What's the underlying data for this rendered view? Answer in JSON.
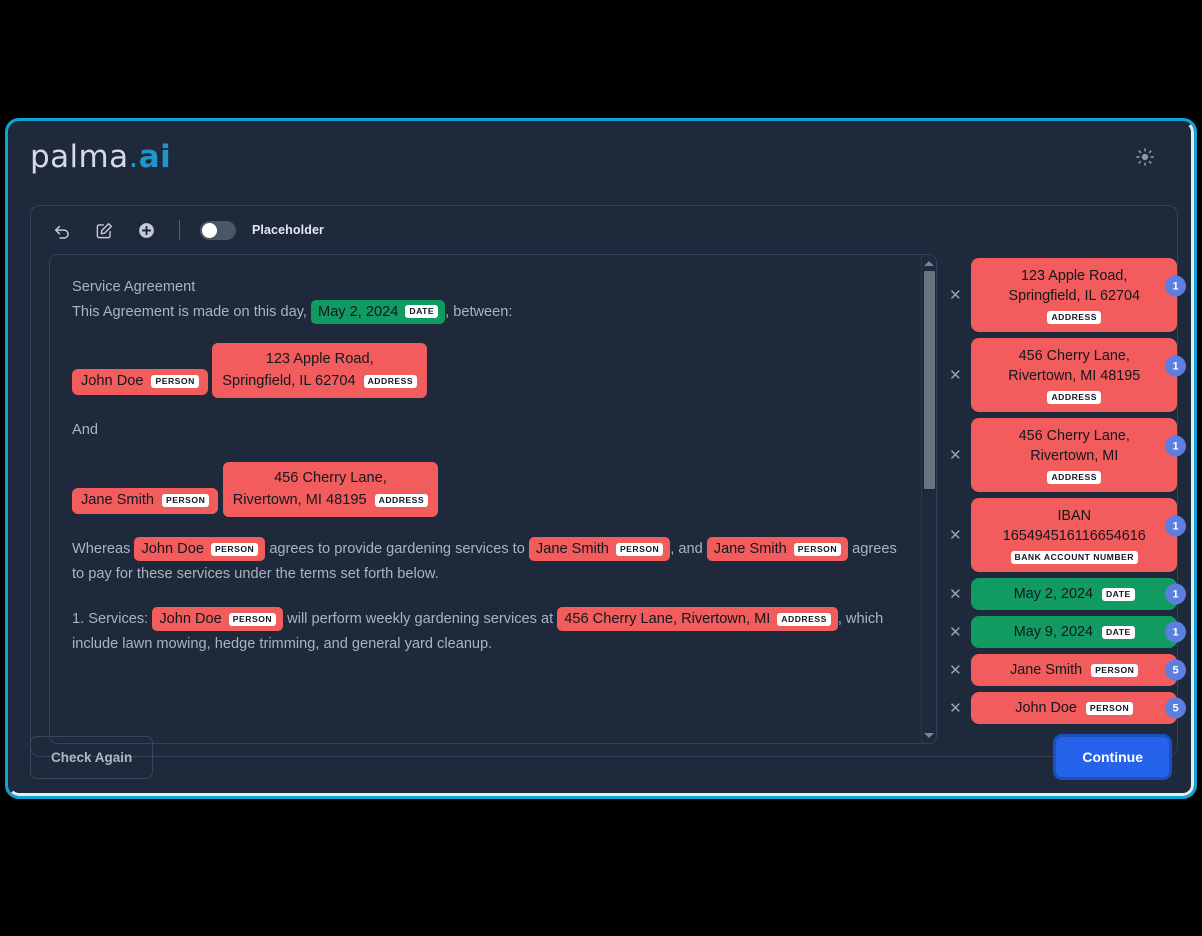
{
  "brand": {
    "name": "palma",
    "dot": ".",
    "suffix": "ai"
  },
  "header": {
    "theme_icon": "sun-icon"
  },
  "toolbar": {
    "undo_icon": "undo-arrow-icon",
    "edit_icon": "edit-square-icon",
    "add_icon": "plus-circle-icon",
    "toggle_state": "on",
    "placeholder_label": "Placeholder"
  },
  "document": {
    "title": "Service Agreement",
    "intro_prefix": "This Agreement is made on this day,",
    "intro_date": "May 2, 2024",
    "intro_date_tag": "DATE",
    "intro_suffix": ", between:",
    "party_one": {
      "name": "John Doe",
      "name_tag": "PERSON",
      "address_line1": "123 Apple Road,",
      "address_line2": "Springfield, IL 62704",
      "address_tag": "ADDRESS"
    },
    "connector": "And",
    "party_two": {
      "name": "Jane Smith",
      "name_tag": "PERSON",
      "address_line1": "456 Cherry Lane,",
      "address_line2": "Rivertown, MI 48195",
      "address_tag": "ADDRESS"
    },
    "whereas": {
      "p1": "Whereas",
      "e1": "John Doe",
      "e1_tag": "PERSON",
      "p2": "agrees to provide gardening services to",
      "e2": "Jane Smith",
      "e2_tag": "PERSON",
      "p3": ", and",
      "e3": "Jane Smith",
      "e3_tag": "PERSON",
      "p4": "agrees to pay for these services under the terms set forth below."
    },
    "services": {
      "p1": "1. Services:",
      "e1": "John Doe",
      "e1_tag": "PERSON",
      "p2": "will perform weekly gardening services at",
      "e2": "456 Cherry Lane, Rivertown, MI",
      "e2_tag": "ADDRESS",
      "p3": ", which include lawn mowing, hedge trimming, and general yard cleanup."
    }
  },
  "scrollbar": {
    "up_icon": "scroll-up-arrow-icon",
    "down_icon": "scroll-down-arrow-icon"
  },
  "entities": [
    {
      "text": "123 Apple Road,\nSpringfield, IL 62704",
      "tag": "ADDRESS",
      "count": "1",
      "color": "red",
      "layout": "stacked",
      "remove_icon": "close-icon"
    },
    {
      "text": "456 Cherry Lane,\nRivertown, MI 48195",
      "tag": "ADDRESS",
      "count": "1",
      "color": "red",
      "layout": "stacked",
      "remove_icon": "close-icon"
    },
    {
      "text": "456 Cherry Lane,\nRivertown, MI",
      "tag": "ADDRESS",
      "count": "1",
      "color": "red",
      "layout": "stacked",
      "remove_icon": "close-icon"
    },
    {
      "text": "IBAN\n165494516116654616",
      "tag": "BANK ACCOUNT NUMBER",
      "count": "1",
      "color": "red",
      "layout": "stacked",
      "remove_icon": "close-icon"
    },
    {
      "text": "May 2, 2024",
      "tag": "DATE",
      "count": "1",
      "color": "green",
      "layout": "compact",
      "remove_icon": "close-icon"
    },
    {
      "text": "May 9, 2024",
      "tag": "DATE",
      "count": "1",
      "color": "green",
      "layout": "compact",
      "remove_icon": "close-icon"
    },
    {
      "text": "Jane Smith",
      "tag": "PERSON",
      "count": "5",
      "color": "red",
      "layout": "compact",
      "remove_icon": "close-icon"
    },
    {
      "text": "John Doe",
      "tag": "PERSON",
      "count": "5",
      "color": "red",
      "layout": "compact",
      "remove_icon": "close-icon"
    }
  ],
  "footer": {
    "check_again_label": "Check Again",
    "continue_label": "Continue"
  },
  "colors": {
    "accent_border": "#0ea5d4",
    "brand_blue": "#2196c9",
    "entity_red": "#f25c5c",
    "entity_green": "#119b63",
    "count_badge": "#5b7fe0",
    "primary_button": "#2563eb",
    "window_bg": "#1e293b",
    "page_bg": "#000000"
  }
}
